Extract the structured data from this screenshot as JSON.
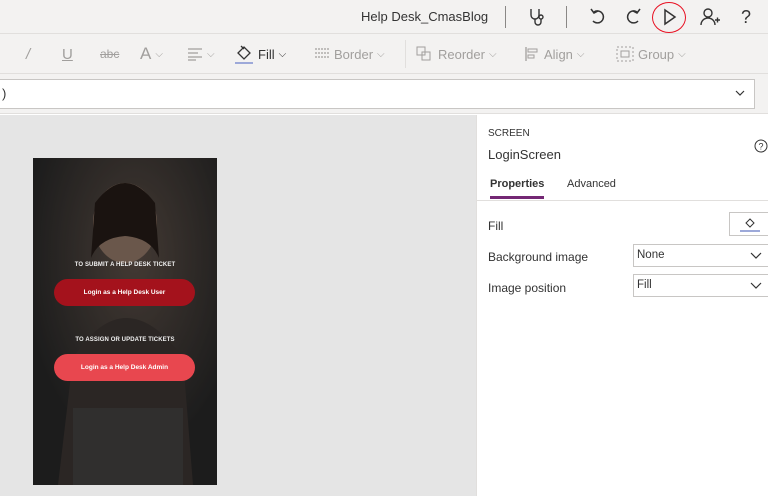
{
  "titlebar": {
    "app_title": "Help Desk_CmasBlog",
    "icons": [
      "stethoscope-icon",
      "undo-icon",
      "redo-icon",
      "play-icon",
      "add-user-icon",
      "help-icon"
    ],
    "annotation_color": "#e81123"
  },
  "toolbar": {
    "fill_label": "Fill",
    "border_label": "Border",
    "reorder_label": "Reorder",
    "align_label": "Align",
    "group_label": "Group"
  },
  "formula": {
    "value": ")"
  },
  "app_preview": {
    "label_user": "TO SUBMIT A HELP DESK TICKET",
    "button_user": "Login as a Help Desk User",
    "label_admin": "TO ASSIGN OR UPDATE TICKETS",
    "button_admin": "Login as a Help Desk Admin",
    "colors": {
      "button_user": "#a4121c",
      "button_admin": "#e8474f"
    }
  },
  "panel": {
    "kind": "SCREEN",
    "name": "LoginScreen",
    "tabs": [
      {
        "label": "Properties",
        "active": true
      },
      {
        "label": "Advanced",
        "active": false
      }
    ],
    "properties": {
      "fill_label": "Fill",
      "background_image_label": "Background image",
      "background_image_value": "None",
      "image_position_label": "Image position",
      "image_position_value": "Fill"
    },
    "accent": "#742774"
  }
}
